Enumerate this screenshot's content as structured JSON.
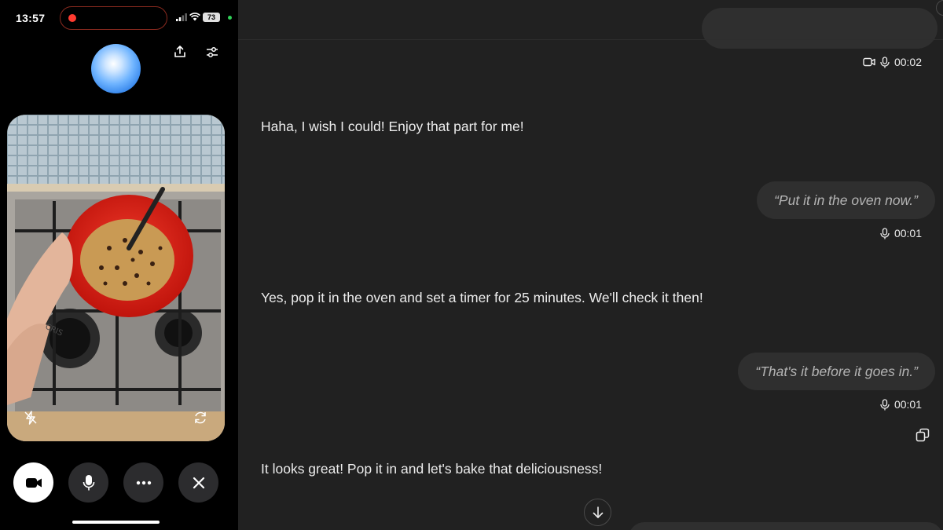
{
  "status_bar": {
    "time": "13:57",
    "battery": "73",
    "recording_color": "#ff3b30"
  },
  "phone": {
    "icons": [
      "share-icon",
      "sliders-icon",
      "flash-off-icon",
      "switch-camera-icon"
    ],
    "controls": [
      {
        "name": "video-button",
        "icon": "video-camera-icon",
        "active": true
      },
      {
        "name": "mic-button",
        "icon": "microphone-icon",
        "active": false
      },
      {
        "name": "more-button",
        "icon": "more-dots-icon",
        "active": false
      },
      {
        "name": "end-button",
        "icon": "close-icon",
        "active": false
      }
    ]
  },
  "conversation": [
    {
      "role": "user",
      "meta": "00:02",
      "video": true
    },
    {
      "role": "assistant",
      "text": "Haha, I wish I could! Enjoy that part for me!"
    },
    {
      "role": "user",
      "text": "“Put it in the oven now.”",
      "meta": "00:01"
    },
    {
      "role": "assistant",
      "text": "Yes, pop it in the oven and set a timer for 25 minutes. We'll check it then!"
    },
    {
      "role": "user",
      "text": "“That's it before it goes in.”",
      "meta": "00:01"
    },
    {
      "role": "assistant",
      "text": "It looks great! Pop it in and let's bake that deliciousness!"
    }
  ],
  "colors": {
    "background": "#212121",
    "bubble": "#2f2f2f",
    "text": "#ececec",
    "user_text": "#b4b4b4"
  }
}
